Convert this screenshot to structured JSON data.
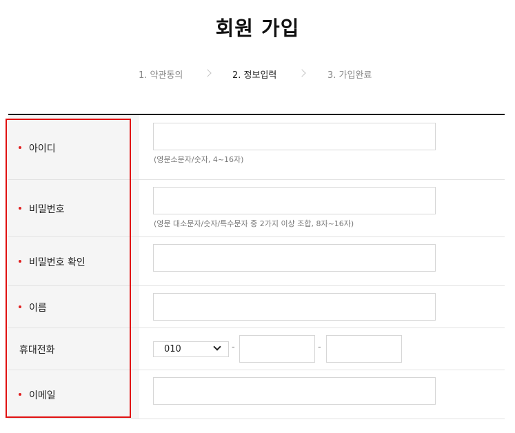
{
  "page": {
    "title": "회원 가입"
  },
  "steps": [
    {
      "label": "1. 약관동의"
    },
    {
      "label": "2. 정보입력"
    },
    {
      "label": "3. 가입완료"
    }
  ],
  "form": {
    "userid": {
      "label": "아이디",
      "hint": "(영문소문자/숫자, 4~16자)",
      "value": ""
    },
    "password": {
      "label": "비밀번호",
      "hint": "(영문 대소문자/숫자/특수문자 중 2가지 이상 조합, 8자~16자)",
      "value": ""
    },
    "password_confirm": {
      "label": "비밀번호 확인",
      "value": ""
    },
    "name": {
      "label": "이름",
      "value": ""
    },
    "phone": {
      "label": "휴대전화",
      "prefix": "010",
      "separator": "-",
      "middle": "",
      "last": ""
    },
    "email": {
      "label": "이메일",
      "value": ""
    }
  },
  "colors": {
    "required_dot": "#e02020",
    "highlight_border": "#e01010"
  }
}
